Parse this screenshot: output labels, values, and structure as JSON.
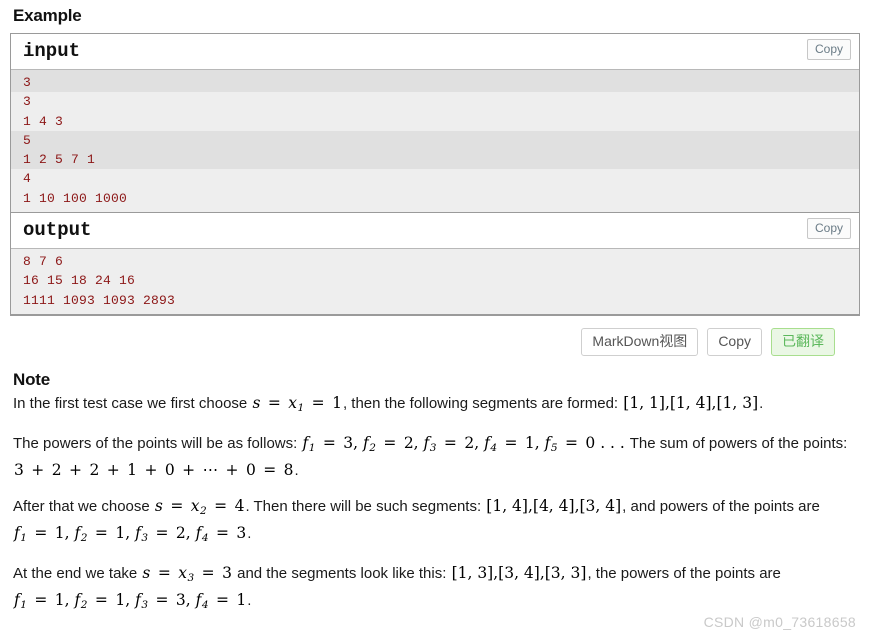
{
  "section": {
    "title": "Example"
  },
  "samples": {
    "copy_label": "Copy",
    "input": {
      "header": "input",
      "groups": [
        {
          "shade": "dark",
          "lines": [
            "3"
          ]
        },
        {
          "shade": "light",
          "lines": [
            "3",
            "1 4 3"
          ]
        },
        {
          "shade": "dark",
          "lines": [
            "5",
            "1 2 5 7 1"
          ]
        },
        {
          "shade": "light",
          "lines": [
            "4",
            "1 10 100 1000"
          ]
        }
      ]
    },
    "output": {
      "header": "output",
      "groups": [
        {
          "shade": "light",
          "lines": [
            "8 7 6",
            "16 15 18 24 16",
            "1111 1093 1093 2893"
          ]
        }
      ]
    }
  },
  "toolbar": {
    "markdown_label": "MarkDown视图",
    "copy_label": "Copy",
    "translated_label": "已翻译"
  },
  "note": {
    "title": "Note",
    "paragraphs": [
      {
        "id": "p1",
        "parts": [
          {
            "t": "text",
            "v": "In the first test case we first choose "
          },
          {
            "t": "math",
            "v": "s = x₁ = 1"
          },
          {
            "t": "text",
            "v": ", then the following segments are formed: "
          },
          {
            "t": "math",
            "v": "[1, 1],[1, 4],[1, 3]"
          },
          {
            "t": "text",
            "v": "."
          }
        ]
      },
      {
        "id": "p2",
        "parts": [
          {
            "t": "text",
            "v": "The powers of the points will be as follows: "
          },
          {
            "t": "math",
            "v": "f₁ = 3, f₂ = 2, f₃ = 2, f₄ = 1, f₅ = 0 . . ."
          },
          {
            "t": "text",
            "v": " The sum of powers of the points: "
          },
          {
            "t": "math",
            "v": "3 + 2 + 2 + 1 + 0 + ⋯ + 0 = 8"
          },
          {
            "t": "text",
            "v": "."
          }
        ]
      },
      {
        "id": "p3",
        "parts": [
          {
            "t": "text",
            "v": "After that we choose "
          },
          {
            "t": "math",
            "v": "s = x₂ = 4"
          },
          {
            "t": "text",
            "v": ". Then there will be such segments: "
          },
          {
            "t": "math",
            "v": "[1, 4],[4, 4],[3, 4]"
          },
          {
            "t": "text",
            "v": ", and powers of the points are "
          },
          {
            "t": "math",
            "v": "f₁ = 1, f₂ = 1, f₃ = 2, f₄ = 3"
          },
          {
            "t": "text",
            "v": "."
          }
        ]
      },
      {
        "id": "p4",
        "parts": [
          {
            "t": "text",
            "v": "At the end we take "
          },
          {
            "t": "math",
            "v": "s = x₃ = 3"
          },
          {
            "t": "text",
            "v": " and the segments look like this: "
          },
          {
            "t": "math",
            "v": "[1, 3],[3, 4],[3, 3]"
          },
          {
            "t": "text",
            "v": ", the powers of the points are "
          },
          {
            "t": "math",
            "v": "f₁ = 1, f₂ = 1, f₃ = 3, f₄ = 1"
          },
          {
            "t": "text",
            "v": "."
          }
        ]
      }
    ]
  },
  "watermark": {
    "text": "CSDN @m0_73618658"
  }
}
